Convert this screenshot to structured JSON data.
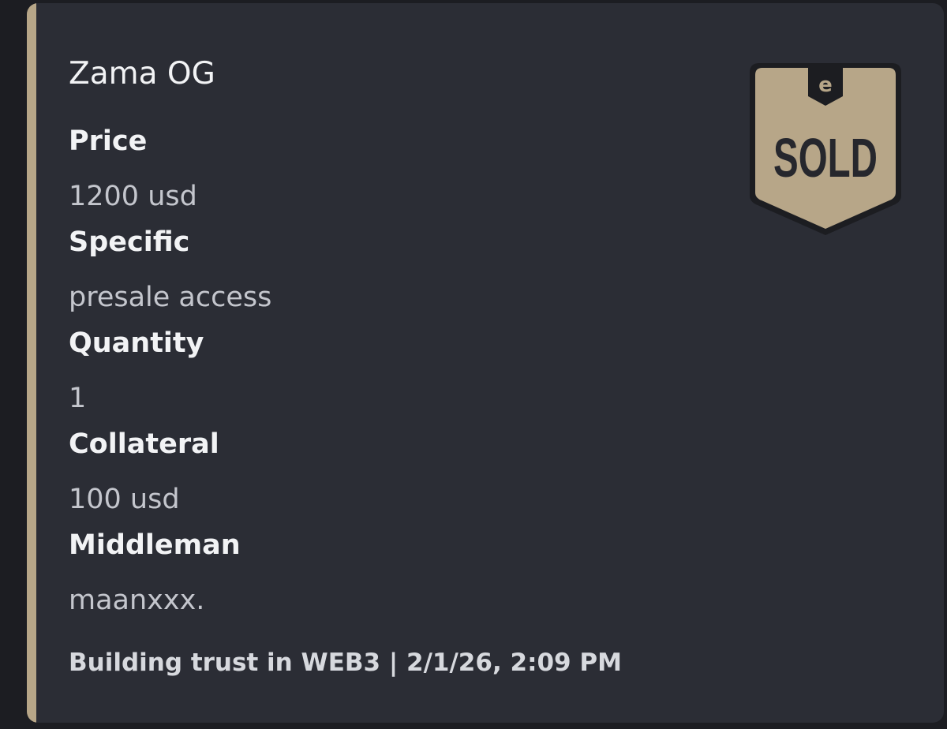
{
  "embed": {
    "title": "Zama OG",
    "accent_color": "#b7a688",
    "fields": [
      {
        "name": "Price",
        "value": "1200 usd"
      },
      {
        "name": "Specific",
        "value": "presale access"
      },
      {
        "name": "Quantity",
        "value": "1"
      },
      {
        "name": "Collateral",
        "value": "100 usd"
      },
      {
        "name": "Middleman",
        "value": "maanxxx."
      }
    ],
    "footer": "Building trust in WEB3 | 2/1/26, 2:09 PM",
    "thumbnail": {
      "icon": "sold-badge-icon",
      "text": "SOLD",
      "logo_letter": "e",
      "badge_color": "#b7a688"
    }
  }
}
